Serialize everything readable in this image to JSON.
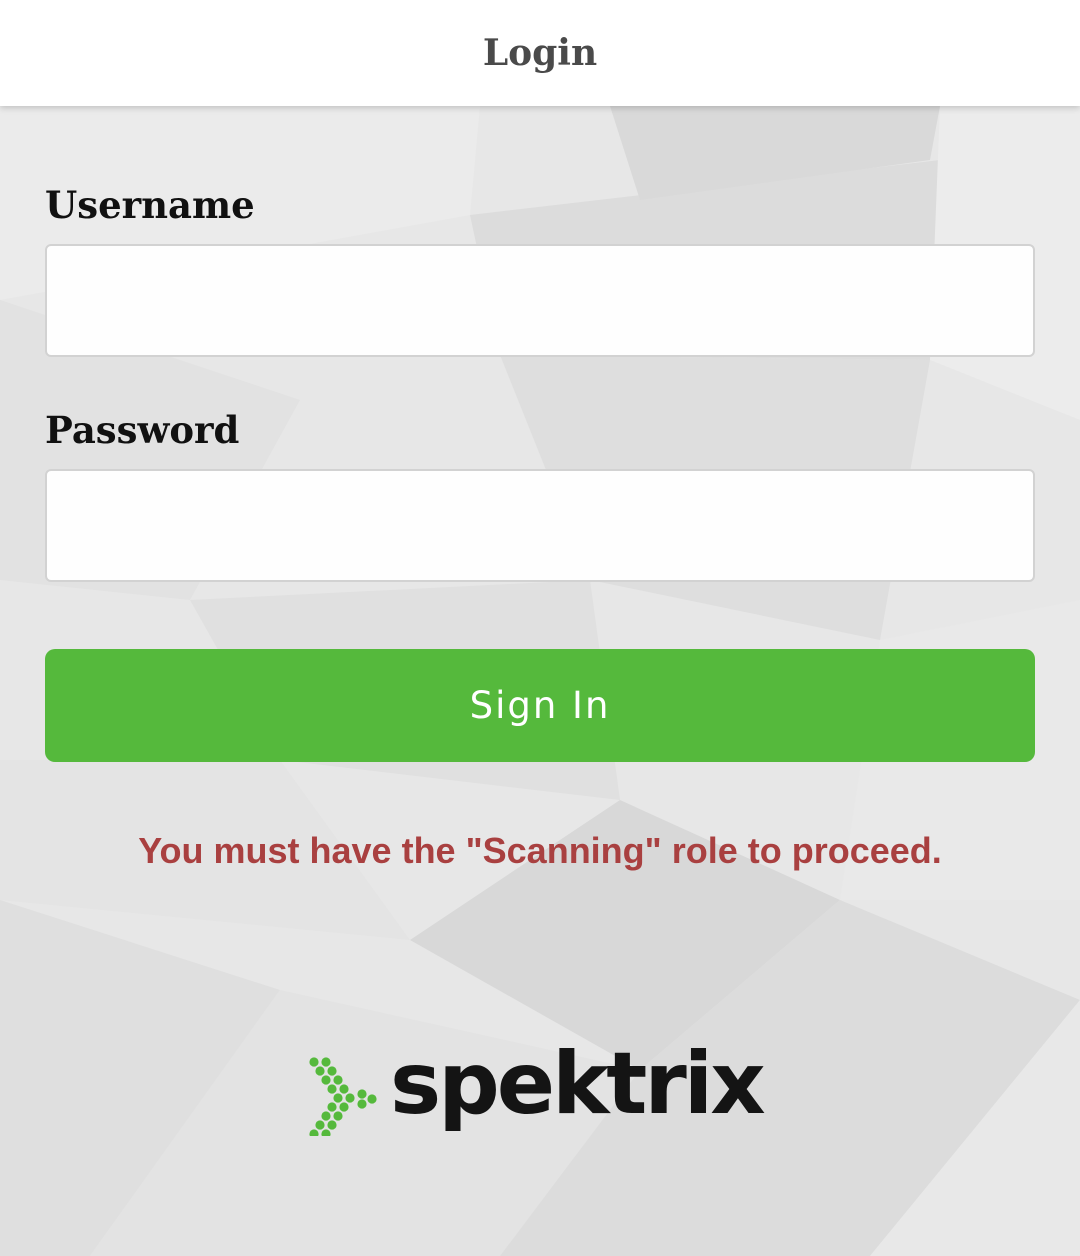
{
  "header": {
    "title": "Login"
  },
  "form": {
    "username_label": "Username",
    "username_value": "",
    "password_label": "Password",
    "password_value": "",
    "signin_label": "Sign In"
  },
  "message": {
    "error": "You must have the \"Scanning\" role to proceed."
  },
  "brand": {
    "name": "spektrix",
    "icon": "spektrix-dotted-arrow-logo"
  },
  "colors": {
    "accent": "#55b93c",
    "error": "#a94040",
    "header_bg": "#ffffff",
    "page_bg": "#e6e6e6"
  }
}
